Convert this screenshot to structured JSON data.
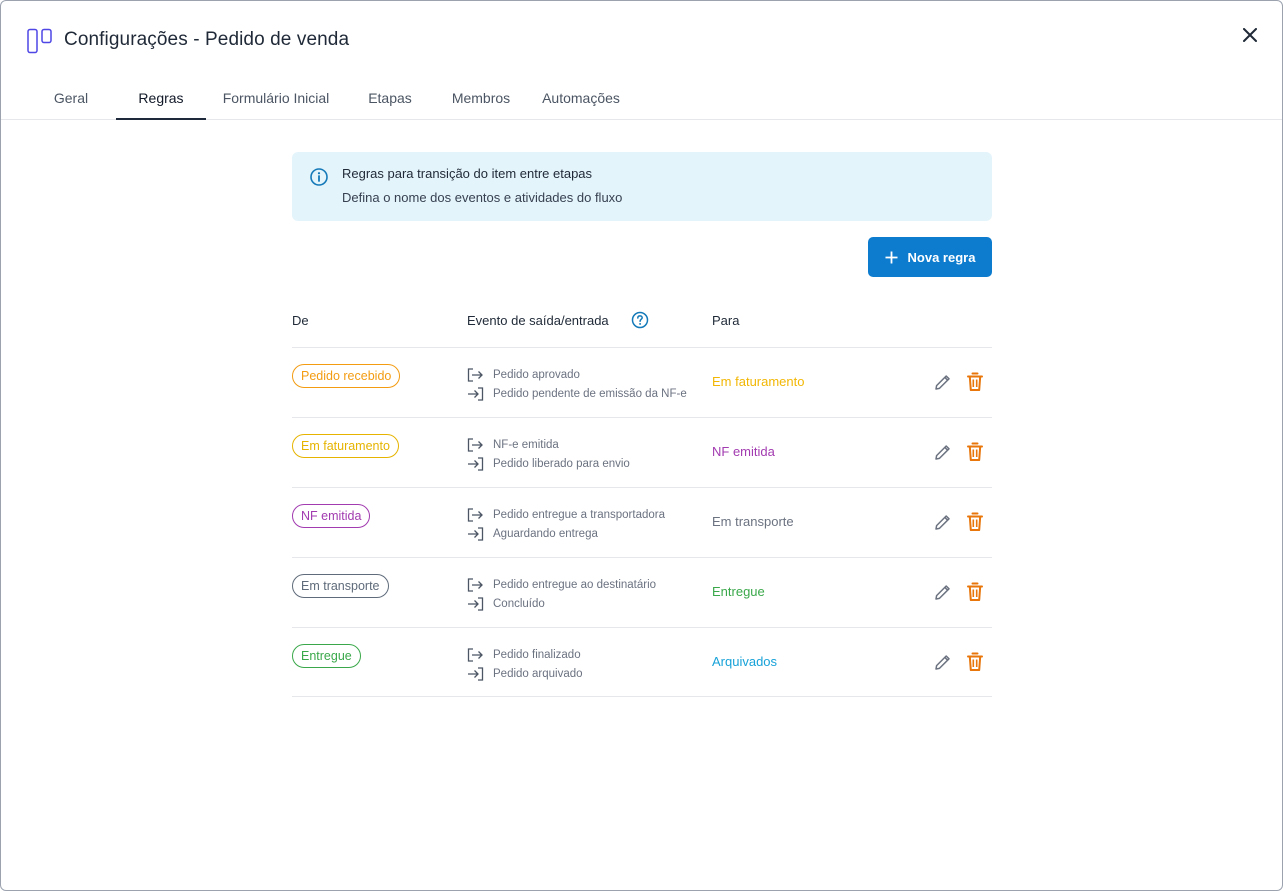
{
  "window": {
    "title": "Configurações - Pedido de venda"
  },
  "tabs": [
    {
      "label": "Geral",
      "active": false
    },
    {
      "label": "Regras",
      "active": true
    },
    {
      "label": "Formulário Inicial",
      "active": false
    },
    {
      "label": "Etapas",
      "active": false
    },
    {
      "label": "Membros",
      "active": false
    },
    {
      "label": "Automações",
      "active": false
    }
  ],
  "info": {
    "title": "Regras para transição do item entre etapas",
    "subtitle": "Defina o nome dos eventos e atividades do fluxo"
  },
  "new_rule_label": "Nova regra",
  "columns": {
    "from": "De",
    "event": "Evento de saída/entrada",
    "to": "Para"
  },
  "rules": [
    {
      "from": "Pedido recebido",
      "from_color": "#f39c12",
      "exit_event": "Pedido aprovado",
      "entry_event": "Pedido pendente de emissão da NF-e",
      "to": "Em faturamento",
      "to_color": "#f2b705"
    },
    {
      "from": "Em faturamento",
      "from_color": "#e6b400",
      "exit_event": "NF-e emitida",
      "entry_event": "Pedido liberado para envio",
      "to": "NF emitida",
      "to_color": "#a23bb0"
    },
    {
      "from": "NF emitida",
      "from_color": "#a23bb0",
      "exit_event": "Pedido entregue a transportadora",
      "entry_event": "Aguardando entrega",
      "to": "Em transporte",
      "to_color": "#6b7280"
    },
    {
      "from": "Em transporte",
      "from_color": "#5f6b7a",
      "exit_event": "Pedido entregue ao destinatário",
      "entry_event": "Concluído",
      "to": "Entregue",
      "to_color": "#3aa84a"
    },
    {
      "from": "Entregue",
      "from_color": "#3aa84a",
      "exit_event": "Pedido finalizado",
      "entry_event": "Pedido arquivado",
      "to": "Arquivados",
      "to_color": "#17a2d8"
    }
  ],
  "colors": {
    "accent": "#0d7ccf",
    "delete": "#e8760a",
    "info_bg": "#e4f4fb"
  },
  "icons": {
    "app": "kanban-icon",
    "close": "close-icon",
    "info": "info-icon",
    "help": "help-icon",
    "exit": "exit-arrow-icon",
    "entry": "entry-arrow-icon",
    "edit": "pencil-icon",
    "delete": "trash-icon"
  }
}
